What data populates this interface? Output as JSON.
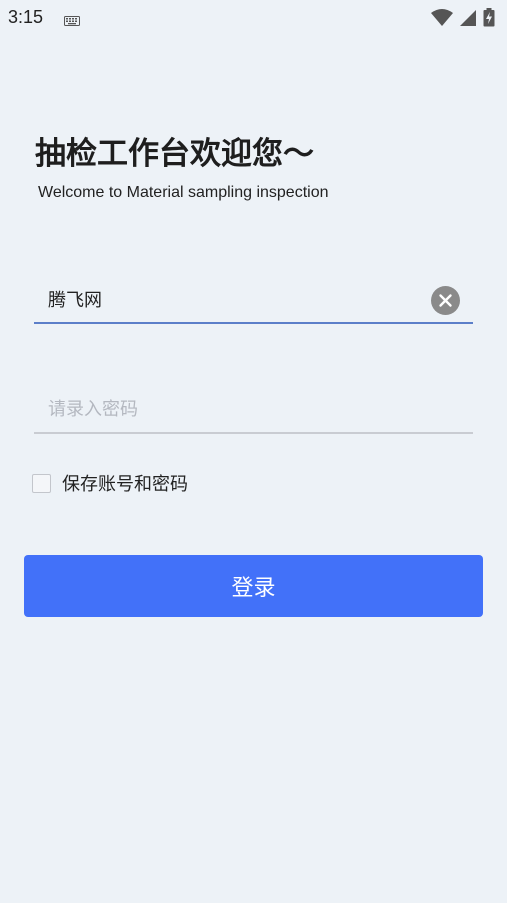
{
  "status_bar": {
    "time": "3:15",
    "icons": [
      "keyboard-icon",
      "wifi-icon",
      "signal-icon",
      "battery-charging-icon"
    ]
  },
  "header": {
    "title": "抽检工作台欢迎您～",
    "subtitle": "Welcome to Material sampling inspection"
  },
  "form": {
    "username": {
      "value": "腾飞网",
      "placeholder": ""
    },
    "password": {
      "value": "",
      "placeholder": "请录入密码"
    },
    "remember": {
      "label": "保存账号和密码",
      "checked": false
    },
    "login_label": "登录"
  },
  "colors": {
    "background": "#edf2f7",
    "primary": "#4271f9",
    "focus_underline": "#5c7fc9"
  }
}
